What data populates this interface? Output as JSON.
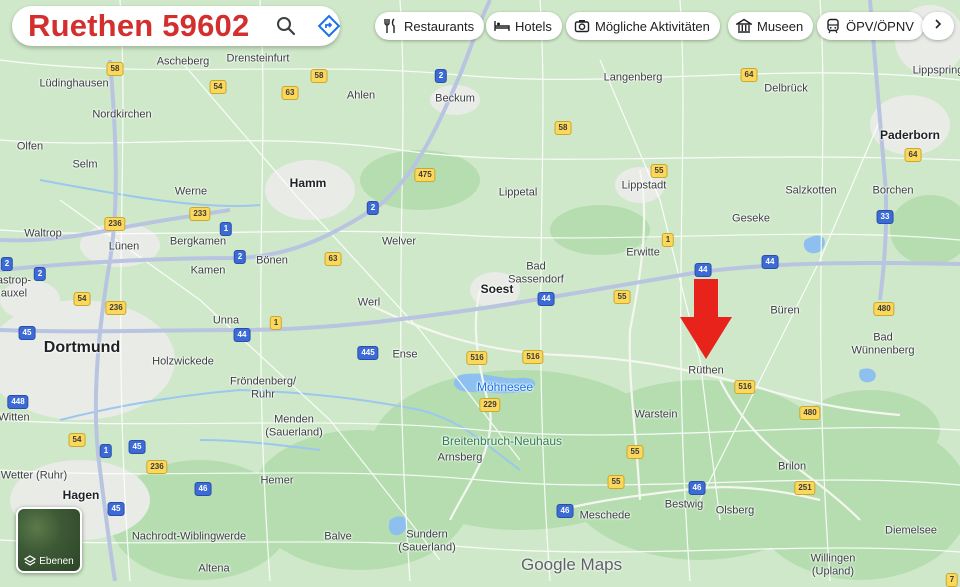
{
  "search": {
    "query": "Ruethen 59602"
  },
  "chips": [
    {
      "id": "restaurants",
      "label": "Restaurants",
      "icon": "fork-knife-icon"
    },
    {
      "id": "hotels",
      "label": "Hotels",
      "icon": "bed-icon"
    },
    {
      "id": "activities",
      "label": "Mögliche Aktivitäten",
      "icon": "camera-icon"
    },
    {
      "id": "museums",
      "label": "Museen",
      "icon": "museum-icon"
    },
    {
      "id": "transit",
      "label": "ÖPV/ÖPNV",
      "icon": "train-icon"
    }
  ],
  "layers": {
    "label": "Ebenen"
  },
  "logo": {
    "text": "Google Maps"
  },
  "colors": {
    "land": "#cfe8c9",
    "forest": "#b5ddb0",
    "urban": "#e8ebe6",
    "water": "#8ec0ef",
    "highway": "#b9c4e0",
    "road": "#ffffff",
    "marker": "#e8231c",
    "search_text": "#d32f2f"
  },
  "marker": {
    "icon": "red-arrow-down-icon",
    "target": "Rüthen"
  },
  "places": [
    {
      "name": "Ascheberg"
    },
    {
      "name": "Drensteinfurt"
    },
    {
      "name": "Lüdinghausen"
    },
    {
      "name": "Ahlen"
    },
    {
      "name": "Beckum"
    },
    {
      "name": "Langenberg"
    },
    {
      "name": "Delbrück"
    },
    {
      "name": "Lippspringe"
    },
    {
      "name": "Nordkirchen"
    },
    {
      "name": "Paderborn"
    },
    {
      "name": "Olfen"
    },
    {
      "name": "Selm"
    },
    {
      "name": "Hamm"
    },
    {
      "name": "Lippetal"
    },
    {
      "name": "Lippstadt"
    },
    {
      "name": "Salzkotten"
    },
    {
      "name": "Borchen"
    },
    {
      "name": "Werne"
    },
    {
      "name": "Geseke"
    },
    {
      "name": "Waltrop"
    },
    {
      "name": "Bergkamen"
    },
    {
      "name": "Lünen"
    },
    {
      "name": "Welver"
    },
    {
      "name": "Erwitte"
    },
    {
      "name": "Kamen"
    },
    {
      "name": "Bönen"
    },
    {
      "name": "Bad\nSassendorf"
    },
    {
      "name": "Soest"
    },
    {
      "name": "Castrop-\nRauxel"
    },
    {
      "name": "Werl"
    },
    {
      "name": "Unna"
    },
    {
      "name": "Büren"
    },
    {
      "name": "Dortmund"
    },
    {
      "name": "Bad\nWünnenberg"
    },
    {
      "name": "Holzwickede"
    },
    {
      "name": "Ense"
    },
    {
      "name": "Rüthen"
    },
    {
      "name": "Möhnesee"
    },
    {
      "name": "Fröndenberg/\nRuhr"
    },
    {
      "name": "Witten"
    },
    {
      "name": "Menden\n(Sauerland)"
    },
    {
      "name": "Warstein"
    },
    {
      "name": "Breitenbruch-Neuhaus"
    },
    {
      "name": "Brilon"
    },
    {
      "name": "Arnsberg"
    },
    {
      "name": "Wetter (Ruhr)"
    },
    {
      "name": "Hemer"
    },
    {
      "name": "Hagen"
    },
    {
      "name": "Bestwig"
    },
    {
      "name": "Olsberg"
    },
    {
      "name": "Meschede"
    },
    {
      "name": "Nachrodt-Wiblingwerde"
    },
    {
      "name": "Balve"
    },
    {
      "name": "Sundern\n(Sauerland)"
    },
    {
      "name": "Diemelsee"
    },
    {
      "name": "Altena"
    },
    {
      "name": "Willingen\n(Upland)"
    }
  ],
  "route_shields": [
    {
      "num": "58",
      "kind": "b"
    },
    {
      "num": "2",
      "kind": "a"
    },
    {
      "num": "64",
      "kind": "b"
    },
    {
      "num": "54",
      "kind": "b"
    },
    {
      "num": "58",
      "kind": "b"
    },
    {
      "num": "63",
      "kind": "b"
    },
    {
      "num": "58",
      "kind": "b"
    },
    {
      "num": "64",
      "kind": "b"
    },
    {
      "num": "55",
      "kind": "b"
    },
    {
      "num": "475",
      "kind": "b"
    },
    {
      "num": "2",
      "kind": "a"
    },
    {
      "num": "233",
      "kind": "b"
    },
    {
      "num": "236",
      "kind": "b"
    },
    {
      "num": "1",
      "kind": "a"
    },
    {
      "num": "33",
      "kind": "a"
    },
    {
      "num": "2",
      "kind": "a"
    },
    {
      "num": "2",
      "kind": "a"
    },
    {
      "num": "2",
      "kind": "a"
    },
    {
      "num": "63",
      "kind": "b"
    },
    {
      "num": "1",
      "kind": "b"
    },
    {
      "num": "44",
      "kind": "a"
    },
    {
      "num": "44",
      "kind": "a"
    },
    {
      "num": "44",
      "kind": "a"
    },
    {
      "num": "55",
      "kind": "b"
    },
    {
      "num": "54",
      "kind": "b"
    },
    {
      "num": "236",
      "kind": "b"
    },
    {
      "num": "480",
      "kind": "b"
    },
    {
      "num": "1",
      "kind": "b"
    },
    {
      "num": "44",
      "kind": "a"
    },
    {
      "num": "45",
      "kind": "a"
    },
    {
      "num": "445",
      "kind": "a"
    },
    {
      "num": "516",
      "kind": "b"
    },
    {
      "num": "516",
      "kind": "b"
    },
    {
      "num": "516",
      "kind": "b"
    },
    {
      "num": "229",
      "kind": "b"
    },
    {
      "num": "448",
      "kind": "a"
    },
    {
      "num": "480",
      "kind": "b"
    },
    {
      "num": "54",
      "kind": "b"
    },
    {
      "num": "1",
      "kind": "a"
    },
    {
      "num": "45",
      "kind": "a"
    },
    {
      "num": "236",
      "kind": "b"
    },
    {
      "num": "55",
      "kind": "b"
    },
    {
      "num": "55",
      "kind": "b"
    },
    {
      "num": "46",
      "kind": "a"
    },
    {
      "num": "46",
      "kind": "a"
    },
    {
      "num": "251",
      "kind": "b"
    },
    {
      "num": "45",
      "kind": "a"
    },
    {
      "num": "46",
      "kind": "a"
    },
    {
      "num": "7",
      "kind": "b"
    }
  ]
}
